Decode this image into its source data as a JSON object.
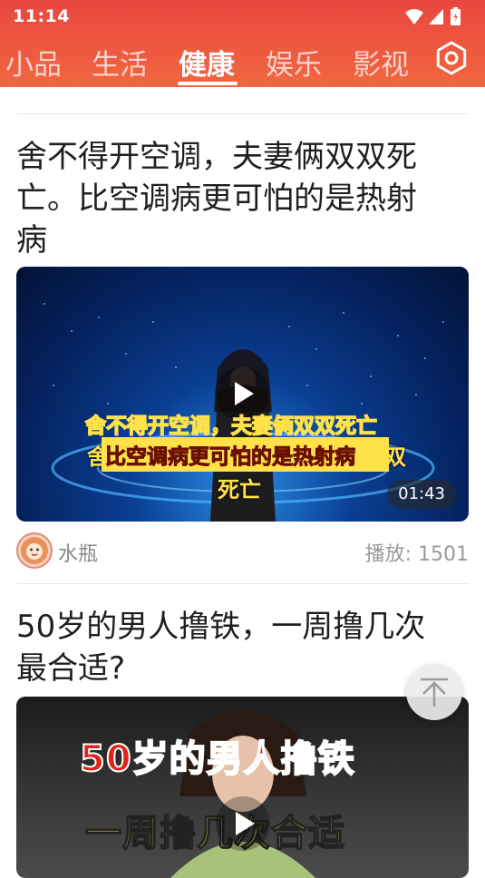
{
  "status": {
    "time": "11:14"
  },
  "tabs": [
    {
      "label": "小品",
      "active": false
    },
    {
      "label": "生活",
      "active": false
    },
    {
      "label": "健康",
      "active": true
    },
    {
      "label": "娱乐",
      "active": false
    },
    {
      "label": "影视",
      "active": false
    }
  ],
  "feed": [
    {
      "title": "舍不得开空调，夫妻俩双双死亡。比空调病更可怕的是热射病",
      "title_lines": [
        "舍不得开空调，夫妻俩双双死",
        "亡。比空调病更可怕的是热射",
        "病"
      ],
      "video_caption_lines": [
        "舍不得开空调，夫妻俩双双死亡",
        "比空调病更可怕的是热射病",
        "死亡"
      ],
      "video_caption_back": "舍",
      "video_caption_back_right": "双",
      "duration": "01:43",
      "author": "水瓶",
      "plays": "播放: 1501"
    },
    {
      "title": "50岁的男人撸铁，一周撸几次最合适?",
      "title_lines": [
        "50岁的男人撸铁，一周撸几次",
        "最合适?"
      ],
      "video_caption_lines": [
        "50岁的男人撸铁",
        "一周撸几次合适"
      ]
    }
  ],
  "colors": {
    "header": "#ee5a40",
    "caption_yellow": "#ffe14a",
    "caption_red": "#e0241c"
  },
  "icons": [
    "wifi-icon",
    "signal-icon",
    "battery-icon",
    "settings-icon",
    "play-icon",
    "back-to-top-icon"
  ]
}
